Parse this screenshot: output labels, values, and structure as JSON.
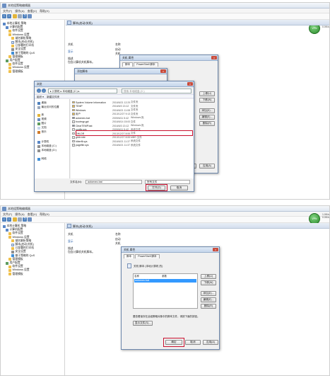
{
  "app": {
    "title": "本地组策略编辑器",
    "menu": [
      "文件(F)",
      "操作(A)",
      "查看(V)",
      "帮助(H)"
    ],
    "tree": [
      {
        "label": "本地计算机 策略",
        "icon": "computer-icon",
        "indent": 0
      },
      {
        "label": "计算机配置",
        "icon": "computer-icon",
        "indent": 1
      },
      {
        "label": "软件设置",
        "icon": "folder-icon",
        "indent": 2
      },
      {
        "label": "Windows 设置",
        "icon": "folder-icon",
        "indent": 2
      },
      {
        "label": "域名解析策略",
        "icon": "folder-icon",
        "indent": 3
      },
      {
        "label": "脚本(启动/关机)",
        "icon": "script-icon",
        "indent": 3
      },
      {
        "label": "已部署的打印机",
        "icon": "folder-icon",
        "indent": 3
      },
      {
        "label": "安全设置",
        "icon": "gear-icon",
        "indent": 3
      },
      {
        "label": "基于策略的 QoS",
        "icon": "chart-icon",
        "indent": 3
      },
      {
        "label": "管理模板",
        "icon": "folder-icon",
        "indent": 2
      },
      {
        "label": "用户配置",
        "icon": "user-icon",
        "indent": 1
      },
      {
        "label": "软件设置",
        "icon": "folder-icon",
        "indent": 2
      },
      {
        "label": "Windows 设置",
        "icon": "folder-icon",
        "indent": 2
      },
      {
        "label": "管理模板",
        "icon": "folder-icon",
        "indent": 2
      }
    ],
    "main_header": "脚本(启动/关机)",
    "col_name": "名称",
    "col_script": "关机",
    "col_display": "显示",
    "col_start": "启动",
    "desc_label": "描述",
    "desc_text": "包含计算机关机脚本。",
    "list_items": [
      "启动",
      "关机"
    ],
    "avatar_text": "VPN",
    "tray_lines": [
      "1.0K/s",
      "0.0K/s"
    ]
  },
  "top_dialogs": {
    "props": {
      "title": "关机 属性",
      "tabs": [
        "脚本",
        "PowerShell 脚本"
      ],
      "buttons": [
        "上移(U)",
        "下移(W)",
        "添加(D)...",
        "编辑(E)...",
        "删除(R)"
      ],
      "behind_title": "添加脚本"
    },
    "open": {
      "title": "浏览",
      "path": "▸ 计算机 ▸ 本地磁盘 (C:) ▸",
      "search": "搜索 本地磁盘 (C:)",
      "commands": [
        "组织 ▾",
        "新建文件夹"
      ],
      "nav": [
        {
          "label": "桌面",
          "icon": "desktop-icon"
        },
        {
          "label": "最近访问的位置",
          "icon": "recent-icon"
        },
        {
          "label": "库",
          "icon": "library-icon"
        },
        {
          "label": "视频",
          "icon": "video-icon"
        },
        {
          "label": "图片",
          "icon": "picture-icon"
        },
        {
          "label": "文档",
          "icon": "document-icon"
        },
        {
          "label": "音乐",
          "icon": "music-icon"
        },
        {
          "label": "计算机",
          "icon": "computer-icon"
        },
        {
          "label": "本地磁盘 (C:)",
          "icon": "drive-icon"
        },
        {
          "label": "本地磁盘 (D:)",
          "icon": "drive-icon"
        },
        {
          "label": "网络",
          "icon": "network-icon"
        }
      ],
      "files": [
        {
          "name": "System Volume Information",
          "date": "2016/6/21 12:29",
          "type": "文件夹",
          "icon": "folder-icon"
        },
        {
          "name": "TEMP",
          "date": "2016/6/3 13:12",
          "type": "文件夹",
          "icon": "folder-icon"
        },
        {
          "name": "Windows",
          "date": "2016/6/21 11:08",
          "type": "文件夹",
          "icon": "folder-icon"
        },
        {
          "name": "用户",
          "date": "2013/12/27 9:13",
          "type": "文件夹",
          "icon": "folder-icon"
        },
        {
          "name": "autoexec.bat",
          "date": "2009/6/11 5:42",
          "type": "Windows 批",
          "icon": "batch-file-icon"
        },
        {
          "name": "bootmgr.gpt",
          "date": "2016/6/14 15:00",
          "type": "文件",
          "icon": "file-icon"
        },
        {
          "name": "ClearTEMP.bat",
          "date": "2016/6/3 13:12",
          "type": "Windows 批",
          "icon": "batch-file-icon"
        },
        {
          "name": "config.sys",
          "date": "2009/6/11 5:42",
          "type": "系统文件",
          "icon": "file-icon"
        },
        {
          "name": "GHLDR",
          "date": "2013/12/27 8:55",
          "type": "文件",
          "icon": "file-icon"
        },
        {
          "name": "grldr.mbr",
          "date": "2013/12/27 8:55",
          "type": "MBR 文件",
          "icon": "file-icon"
        },
        {
          "name": "hiberfil.sys",
          "date": "2016/6/21 11:37",
          "type": "系统文件",
          "icon": "file-icon"
        },
        {
          "name": "pagefile.sys",
          "date": "2016/6/21 11:37",
          "type": "系统文件",
          "icon": "file-icon"
        }
      ],
      "filename_label": "文件名(N):",
      "filename_value": "autoexec.bat",
      "filetype_value": "所有文件",
      "open_button": "打开(O)",
      "cancel_button": "取消"
    },
    "side_buttons": [
      "确定",
      "取消",
      "应用(A)"
    ]
  },
  "bottom_dialog": {
    "title": "关机 属性",
    "tabs": [
      "脚本",
      "PowerShell 脚本"
    ],
    "desc": "关机 脚本 (本地计算机 的)",
    "col_name": "名称",
    "col_params": "参数",
    "script_row": "autoexec.bat",
    "buttons": [
      "上移(U)",
      "下移(W)",
      "添加(D)...",
      "编辑(E)...",
      "删除(R)"
    ],
    "hint": "要查看保存在此组策略对象中的脚本文件，请按下面的按钮。",
    "show_files": "显示文件(S)...",
    "ok": "确定",
    "cancel": "取消",
    "apply": "应用(A)"
  },
  "colors": {
    "accent": "#3399ff",
    "highlight": "#c8102e",
    "titlebar": "#dfe7f1"
  }
}
